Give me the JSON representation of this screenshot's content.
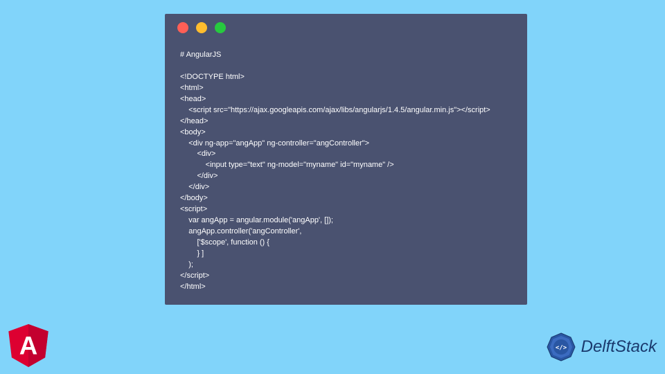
{
  "code_lines": [
    "# AngularJS",
    "",
    "<!DOCTYPE html>",
    "<html>",
    "<head>",
    "    <script src=\"https://ajax.googleapis.com/ajax/libs/angularjs/1.4.5/angular.min.js\"></script>",
    "</head>",
    "<body>",
    "    <div ng-app=\"angApp\" ng-controller=\"angController\">",
    "        <div>",
    "            <input type=\"text\" ng-model=\"myname\" id=\"myname\" />",
    "        </div>",
    "    </div>",
    "</body>",
    "<script>",
    "    var angApp = angular.module('angApp', []);",
    "    angApp.controller('angController',",
    "        ['$scope', function () {",
    "        } ]",
    "    );",
    "</script>",
    "</html>"
  ],
  "brand": "DelftStack",
  "angular_letter": "A"
}
